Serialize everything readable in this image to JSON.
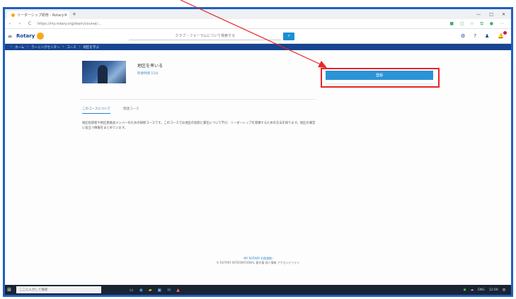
{
  "browser": {
    "tab_title": "リーダーシップ研修 - Rotary",
    "new_tab": "+",
    "url": "https://my.rotary.org/learn/course/...",
    "window_controls": [
      "—",
      "□",
      "✕"
    ],
    "nav_back": "‹",
    "nav_forward": "›",
    "nav_reload": "C"
  },
  "header": {
    "brand": "Rotary",
    "menu_icon": "≡",
    "search_placeholder": "クラブ・フォーラムについて検索する",
    "search_icon": "⌕"
  },
  "breadcrumb": [
    "ホーム",
    "ラーニングセンター",
    "コース",
    "地区を学ぶ"
  ],
  "course": {
    "title": "地区を率いる",
    "subtitle": "所要時間 15分",
    "enroll_label": "登録"
  },
  "tabs": [
    "このコースについて",
    "関連コース"
  ],
  "description": "地区指導者や地区委員会メンバーのための研修コースです。このコースでは地区の役割と責任について学び、リーダーシップを発揮するための方法を探ります。地区の運営に役立つ情報をまとめています。",
  "footer": {
    "link": "MY ROTARY 利用規約",
    "line": "© ROTARY INTERNATIONAL 著作権 個人情報 アクセシビリティ"
  },
  "taskbar": {
    "start_icon": "⊞",
    "search_placeholder": "ここに入力して検索",
    "tray_text": "ENG",
    "clock": "12:00"
  },
  "colors": {
    "accent": "#17458f",
    "button": "#2b93d6",
    "highlight": "#e5262a"
  }
}
